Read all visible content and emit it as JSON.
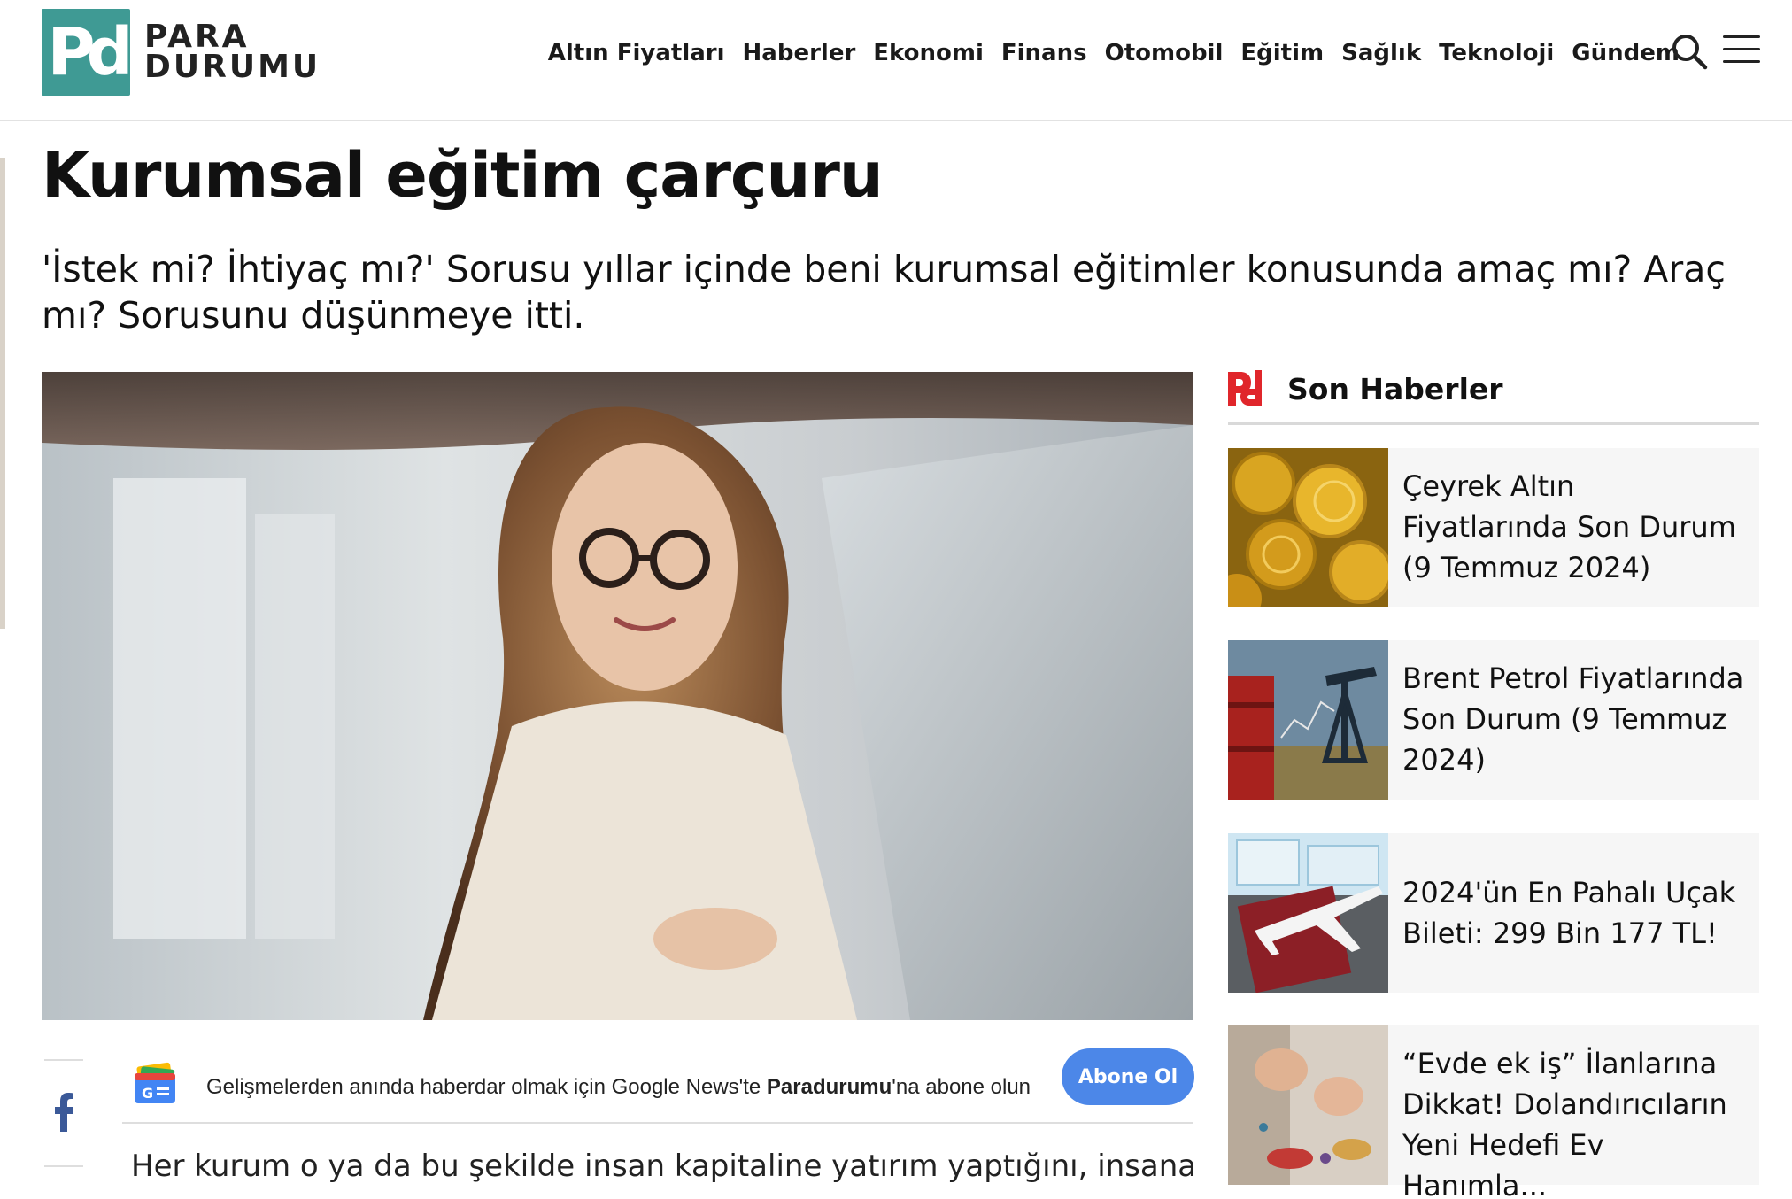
{
  "brand": {
    "mark": "Pd",
    "line1": "PARA",
    "line2": "DURUMU",
    "color": "#3f9a94"
  },
  "nav": [
    "Altın Fiyatları",
    "Haberler",
    "Ekonomi",
    "Finans",
    "Otomobil",
    "Eğitim",
    "Sağlık",
    "Teknoloji",
    "Gündem"
  ],
  "icons": {
    "search": "search-icon",
    "menu": "hamburger-menu-icon",
    "facebook": "facebook-icon",
    "google_news": "google-news-icon"
  },
  "article": {
    "title": "Kurumsal eğitim çarçuru",
    "lead": "'İstek mi? İhtiyaç mı?' Sorusu yıllar içinde beni kurumsal eğitimler konusunda amaç mı? Araç mı? Sorusunu düşünmeye itti.",
    "body_start": "Her kurum o ya da bu şekilde insan kapitaline yatırım yaptığını, insana"
  },
  "google_news": {
    "text_before": "Gelişmelerden anında haberdar olmak için Google News'te ",
    "brand": "Paradurumu",
    "text_after": "'na abone olun",
    "button": "Abone Ol",
    "button_color": "#4c87e8"
  },
  "sidebar": {
    "title": "Son Haberler",
    "accent": "#e0262b",
    "items": [
      {
        "title": "Çeyrek Altın Fiyatlarında Son Durum (9 Temmuz 2024)"
      },
      {
        "title": "Brent Petrol Fiyatlarında Son Durum (9 Temmuz 2024)"
      },
      {
        "title": "2024'ün En Pahalı Uçak Bileti: 299 Bin 177 TL!"
      },
      {
        "title": "“Evde ek iş” İlanlarına Dikkat! Dolandırıcıların Yeni Hedefi Ev Hanımla..."
      }
    ]
  }
}
